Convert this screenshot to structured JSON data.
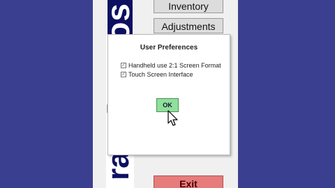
{
  "brand": {
    "top_text": "pos",
    "bottom_text": "ral"
  },
  "menu": {
    "inventory_label": "Inventory",
    "adjustments_label": "Adjustments",
    "exit_label": "Exit"
  },
  "dialog": {
    "title": "User Preferences",
    "options": [
      {
        "label": "Handheld use 2:1 Screen Format",
        "checked": true
      },
      {
        "label": "Touch Screen Interface",
        "checked": true
      }
    ],
    "ok_label": "OK"
  },
  "colors": {
    "background": "#3b3f8f",
    "brand_dark": "#0d1060",
    "ok_green": "#8fe09b",
    "exit_red": "#e67c7c"
  },
  "icons": {
    "pointer": "mouse-pointer-icon"
  }
}
